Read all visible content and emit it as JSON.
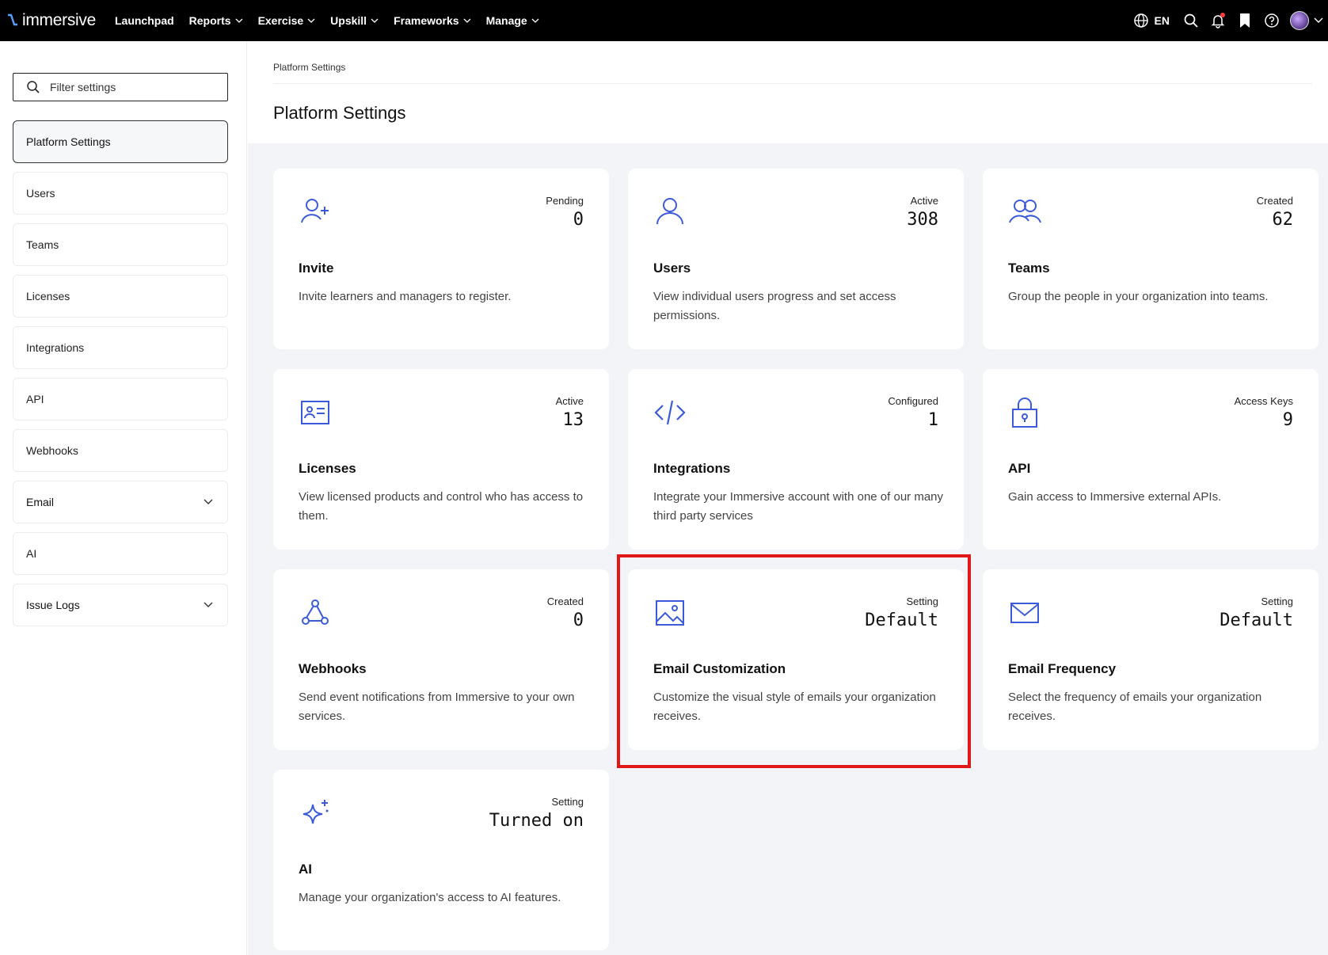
{
  "nav": {
    "brand": "immersive",
    "links": [
      {
        "label": "Launchpad",
        "has_dropdown": false
      },
      {
        "label": "Reports",
        "has_dropdown": true
      },
      {
        "label": "Exercise",
        "has_dropdown": true
      },
      {
        "label": "Upskill",
        "has_dropdown": true
      },
      {
        "label": "Frameworks",
        "has_dropdown": true
      },
      {
        "label": "Manage",
        "has_dropdown": true
      }
    ],
    "language": "EN",
    "icons": [
      "globe-icon",
      "search-icon",
      "bell-icon",
      "bookmark-icon",
      "help-icon",
      "avatar"
    ]
  },
  "sidebar": {
    "filter_placeholder": "Filter settings",
    "items": [
      {
        "label": "Platform Settings",
        "active": true
      },
      {
        "label": "Users"
      },
      {
        "label": "Teams"
      },
      {
        "label": "Licenses"
      },
      {
        "label": "Integrations"
      },
      {
        "label": "API"
      },
      {
        "label": "Webhooks"
      },
      {
        "label": "Email",
        "expandable": true
      },
      {
        "label": "AI"
      },
      {
        "label": "Issue Logs",
        "expandable": true
      }
    ]
  },
  "main": {
    "breadcrumb": "Platform Settings",
    "title": "Platform Settings",
    "cards": [
      {
        "icon": "user-plus-icon",
        "stat_label": "Pending",
        "stat_value": "0",
        "title": "Invite",
        "description": "Invite learners and managers to register."
      },
      {
        "icon": "user-icon",
        "stat_label": "Active",
        "stat_value": "308",
        "title": "Users",
        "description": "View individual users progress and set access permissions."
      },
      {
        "icon": "users-icon",
        "stat_label": "Created",
        "stat_value": "62",
        "title": "Teams",
        "description": "Group the people in your organization into teams."
      },
      {
        "icon": "id-card-icon",
        "stat_label": "Active",
        "stat_value": "13",
        "title": "Licenses",
        "description": "View licensed products and control who has access to them."
      },
      {
        "icon": "code-icon",
        "stat_label": "Configured",
        "stat_value": "1",
        "title": "Integrations",
        "description": "Integrate your Immersive account with one of our many third party services"
      },
      {
        "icon": "lock-icon",
        "stat_label": "Access Keys",
        "stat_value": "9",
        "title": "API",
        "description": "Gain access to Immersive external APIs."
      },
      {
        "icon": "webhook-icon",
        "stat_label": "Created",
        "stat_value": "0",
        "title": "Webhooks",
        "description": "Send event notifications from Immersive to your own services."
      },
      {
        "icon": "image-icon",
        "stat_label": "Setting",
        "stat_value": "Default",
        "title": "Email Customization",
        "description": "Customize the visual style of emails your organization receives."
      },
      {
        "icon": "mail-icon",
        "stat_label": "Setting",
        "stat_value": "Default",
        "title": "Email Frequency",
        "description": "Select the frequency of emails your organization receives."
      },
      {
        "icon": "sparkle-icon",
        "stat_label": "Setting",
        "stat_value": "Turned on",
        "title": "AI",
        "description": "Manage your organization's access to AI features."
      }
    ]
  },
  "colors": {
    "accent": "#3b5bdb",
    "nav_bg": "#000000",
    "content_bg": "#f3f4f7",
    "highlight": "#e01818"
  }
}
